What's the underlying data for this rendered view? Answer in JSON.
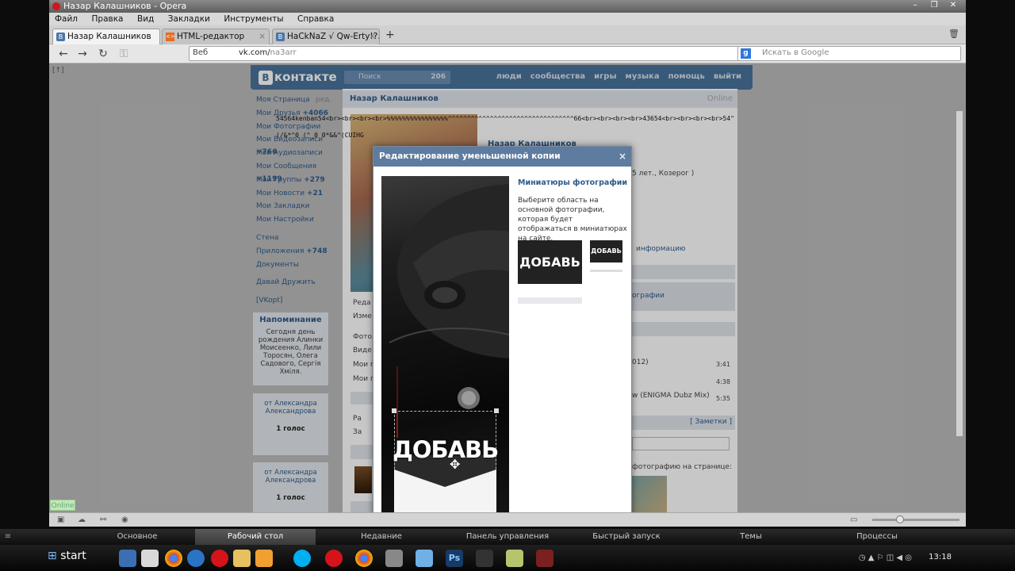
{
  "window": {
    "title": "Назар Калашников - Opera",
    "menu": [
      "Файл",
      "Правка",
      "Вид",
      "Закладки",
      "Инструменты",
      "Справка"
    ]
  },
  "tabs": [
    {
      "label": "Назар Калашников"
    },
    {
      "label": "HTML-редактор"
    },
    {
      "label": "HaCkNaZ √ Qw-Erty!?..."
    }
  ],
  "address": {
    "scope": "Веб",
    "url_host": "vk.com/",
    "url_path": "na3arr",
    "search_placeholder": "Искать в Google",
    "page_corner": "[↑]"
  },
  "vk": {
    "logo": "контакте",
    "logo_letter": "В",
    "search_placeholder": "Поиск",
    "search_count": "206",
    "nav": [
      "люди",
      "сообщества",
      "игры",
      "музыка",
      "помощь",
      "выйти"
    ],
    "left_menu": [
      {
        "label": "Моя Страница",
        "extra": "ред."
      },
      {
        "label": "Мои Друзья",
        "count": "+4066"
      },
      {
        "label": "Мои Фотографии"
      },
      {
        "label": "Мои Видеозаписи",
        "count": "+766"
      },
      {
        "label": "Мои Аудиозаписи"
      },
      {
        "label": "Мои Сообщения",
        "count": "+1199"
      },
      {
        "label": "Мои Группы",
        "count": "+279"
      },
      {
        "label": "Мои Новости",
        "count": "+21"
      },
      {
        "label": "Мои Закладки"
      },
      {
        "label": "Мои Настройки"
      }
    ],
    "left_menu2": [
      {
        "label": "Стена"
      },
      {
        "label": "Приложения",
        "count": "+748"
      },
      {
        "label": "Документы"
      }
    ],
    "left_menu3": [
      {
        "label": "Давай Дружить"
      },
      {
        "label": "[VKopt]"
      }
    ],
    "reminder": {
      "title": "Напоминание",
      "text": "Сегодня день рождения Алинки Моисеенко, Лили Торосян, Олега Садового, Сергія Хміля."
    },
    "votes": [
      {
        "from": "от Александра Александрова",
        "count": "1 голос"
      },
      {
        "from": "от Александра Александрова",
        "count": "1 голос"
      }
    ],
    "page_title": "Назар Калашников",
    "online": "Online",
    "garbage_line1": "54564kenban54<br><br><br><br>%%%%%%%%%%%%%%%%^^^^^^^^^^^^^^^^^^^^^^^^^^^^^^^^^66<br><br><br><br>43654<br><br><br><br>54\"",
    "garbage_line2": "(/&*^0  (^_0  0*&&^(CUIHG",
    "name_right": "Назар Калашников",
    "age_text": "5 лет., Козерог )",
    "more_info": "информацию",
    "photos_link": "ографии",
    "side_labels": [
      "Реда",
      "Изме",
      "Фото",
      "Виде",
      "Мои п",
      "Мои п",
      "Ра",
      "За"
    ],
    "songs": [
      {
        "title": "012)",
        "time": "3:41"
      },
      {
        "title": "",
        "time": "4:38"
      },
      {
        "title": "w (ENIGMA Dubz Mix)",
        "time": "5:35"
      }
    ],
    "notes": "[ Заметки ]",
    "photo_on_page": "фотографию на странице:"
  },
  "dialog": {
    "title": "Редактирование уменьшенной копии",
    "close": "×",
    "thumbs_title": "Миниатюры фотографии",
    "thumbs_desc": "Выберите область на основной фотографии, которая будет отображаться в миниатюрах на сайте.",
    "photo_text": "ДОБАВЬ"
  },
  "statusbar": {
    "online": "Online"
  },
  "winbar": {
    "tabs": [
      "Основное",
      "Рабочий стол",
      "Недавние",
      "Панель управления",
      "Быстрый запуск",
      "Темы",
      "Процессы"
    ],
    "active": "Рабочий стол"
  },
  "taskbar": {
    "start": "start",
    "clock": "13:18"
  }
}
